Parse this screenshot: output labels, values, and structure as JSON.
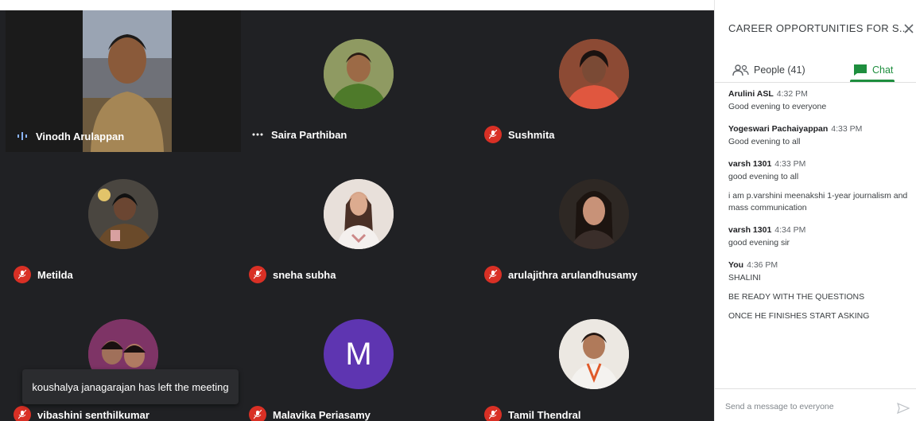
{
  "participants": [
    {
      "name": "Vinodh Arulappan",
      "status": "speaking",
      "avatar": "video"
    },
    {
      "name": "Saira Parthiban",
      "status": "dots",
      "avatar": "photo"
    },
    {
      "name": "Sushmita",
      "status": "muted",
      "avatar": "photo"
    },
    {
      "name": "Metilda",
      "status": "muted",
      "avatar": "photo"
    },
    {
      "name": "sneha subha",
      "status": "muted",
      "avatar": "photo"
    },
    {
      "name": "arulajithra arulandhusamy",
      "status": "muted",
      "avatar": "photo"
    },
    {
      "name": "vibashini senthilkumar",
      "status": "muted",
      "avatar": "photo"
    },
    {
      "name": "Malavika Periasamy",
      "status": "muted",
      "avatar": "letter",
      "letter": "M"
    },
    {
      "name": "Tamil Thendral",
      "status": "muted",
      "avatar": "photo"
    }
  ],
  "notification": "koushalya janagarajan has left the meeting",
  "panel": {
    "title": "CAREER OPPORTUNITIES FOR S...",
    "people_tab": "People (41)",
    "chat_tab": "Chat",
    "messages": [
      {
        "sender": "Arulini ASL",
        "time": "4:32 PM",
        "lines": [
          "Good evening to everyone"
        ]
      },
      {
        "sender": "Yogeswari Pachaiyappan",
        "time": "4:33 PM",
        "lines": [
          "Good evening to all"
        ]
      },
      {
        "sender": "varsh 1301",
        "time": "4:33 PM",
        "lines": [
          "good evening to all",
          "i am p.varshini meenakshi 1-year journalism and mass communication"
        ]
      },
      {
        "sender": "varsh 1301",
        "time": "4:34 PM",
        "lines": [
          "good evening sir"
        ]
      },
      {
        "sender": "You",
        "time": "4:36 PM",
        "lines": [
          "SHALINI",
          "BE READY WITH THE QUESTIONS",
          "ONCE HE FINISHES START ASKING"
        ]
      }
    ],
    "composer_placeholder": "Send a message to everyone"
  },
  "colors": {
    "grid_bg": "#202124",
    "muted_red": "#d93025",
    "chat_green": "#1e8e3e",
    "letter_avatar": "#5e35b1"
  }
}
